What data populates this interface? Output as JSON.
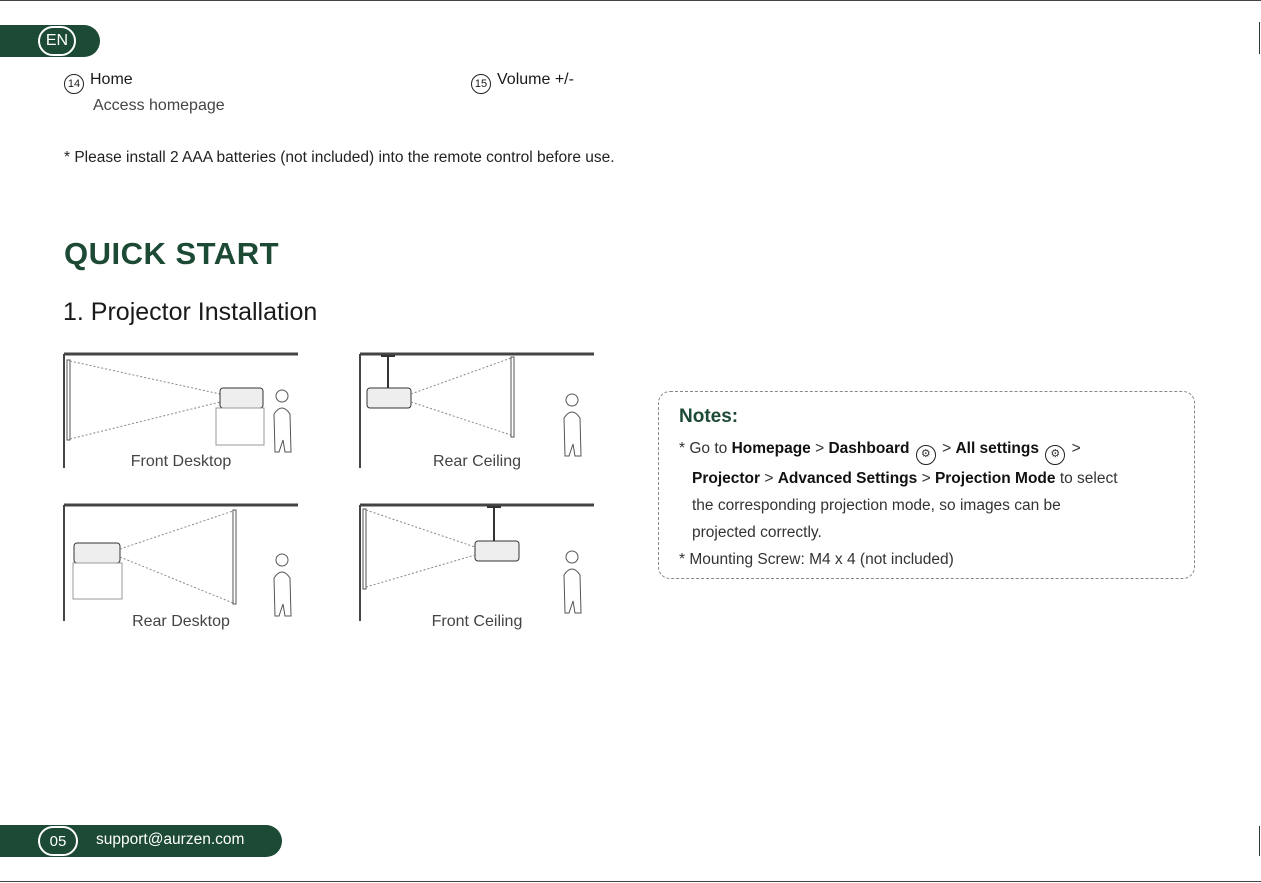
{
  "header": {
    "lang_badge": "EN"
  },
  "items": [
    {
      "num": "14",
      "title": "Home",
      "desc": "Access homepage"
    },
    {
      "num": "15",
      "title": "Volume +/-",
      "desc": ""
    }
  ],
  "battery_note": "* Please install 2 AAA batteries (not included) into the remote control before use.",
  "section_title": "QUICK START",
  "subsection_title": "1. Projector Installation",
  "diagrams": {
    "front_desktop": "Front Desktop",
    "rear_ceiling": "Rear Ceiling",
    "rear_desktop": "Rear Desktop",
    "front_ceiling": "Front Ceiling"
  },
  "notes": {
    "title": "Notes:",
    "line1_prefix": "* Go to ",
    "homepage": "Homepage",
    "sep1": " > ",
    "dashboard": "Dashboard",
    "sep2": " > ",
    "all_settings": "All settings",
    "sep3": " >",
    "projector": "Projector",
    "sep4": " > ",
    "advanced": "Advanced Settings",
    "sep5": " > ",
    "projection_mode": "Projection Mode",
    "line2_suffix": " to select",
    "line3": "the corresponding projection mode, so images can be",
    "line4": "projected correctly.",
    "line5": "* Mounting Screw: M4 x 4 (not included)",
    "gear_icon": "gear-icon"
  },
  "footer": {
    "page_number": "05",
    "email": "support@aurzen.com"
  },
  "colors": {
    "brand": "#1c4a35"
  }
}
